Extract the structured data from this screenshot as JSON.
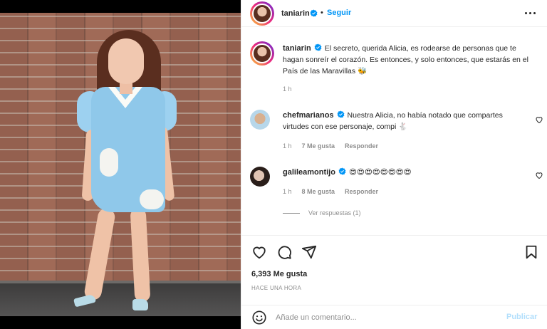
{
  "post": {
    "author": "taniarin",
    "follow_label": "Seguir",
    "dot": "•"
  },
  "caption": {
    "username": "taniarin",
    "text": "El secreto, querida Alicia, es rodearse de personas que te hagan sonreír el corazón. Es entonces, y solo entonces, que estarás en el País de las Maravillas 🐝",
    "time": "1 h"
  },
  "comments": [
    {
      "username": "chefmarianos",
      "text": "Nuestra Alicia, no había notado que compartes virtudes con ese personaje, compi 🐇",
      "time": "1 h",
      "likes": "7 Me gusta",
      "reply": "Responder"
    },
    {
      "username": "galileamontijo",
      "text": "😍😍😍😍😍😍😍😍",
      "time": "1 h",
      "likes": "8 Me gusta",
      "reply": "Responder"
    }
  ],
  "view_replies": "Ver respuestas (1)",
  "likes_count": "6,393 Me gusta",
  "posted_time": "HACE UNA HORA",
  "comment_box": {
    "placeholder": "Añade un comentario...",
    "publish_label": "Publicar"
  },
  "colors": {
    "accent": "#0095f6",
    "publish_disabled": "#b2dffc",
    "muted": "#8e8e8e",
    "text": "#262626"
  },
  "icons": [
    "verified-badge-icon",
    "more-options-icon",
    "heart-icon",
    "comment-icon",
    "share-icon",
    "bookmark-icon",
    "emoji-icon"
  ]
}
